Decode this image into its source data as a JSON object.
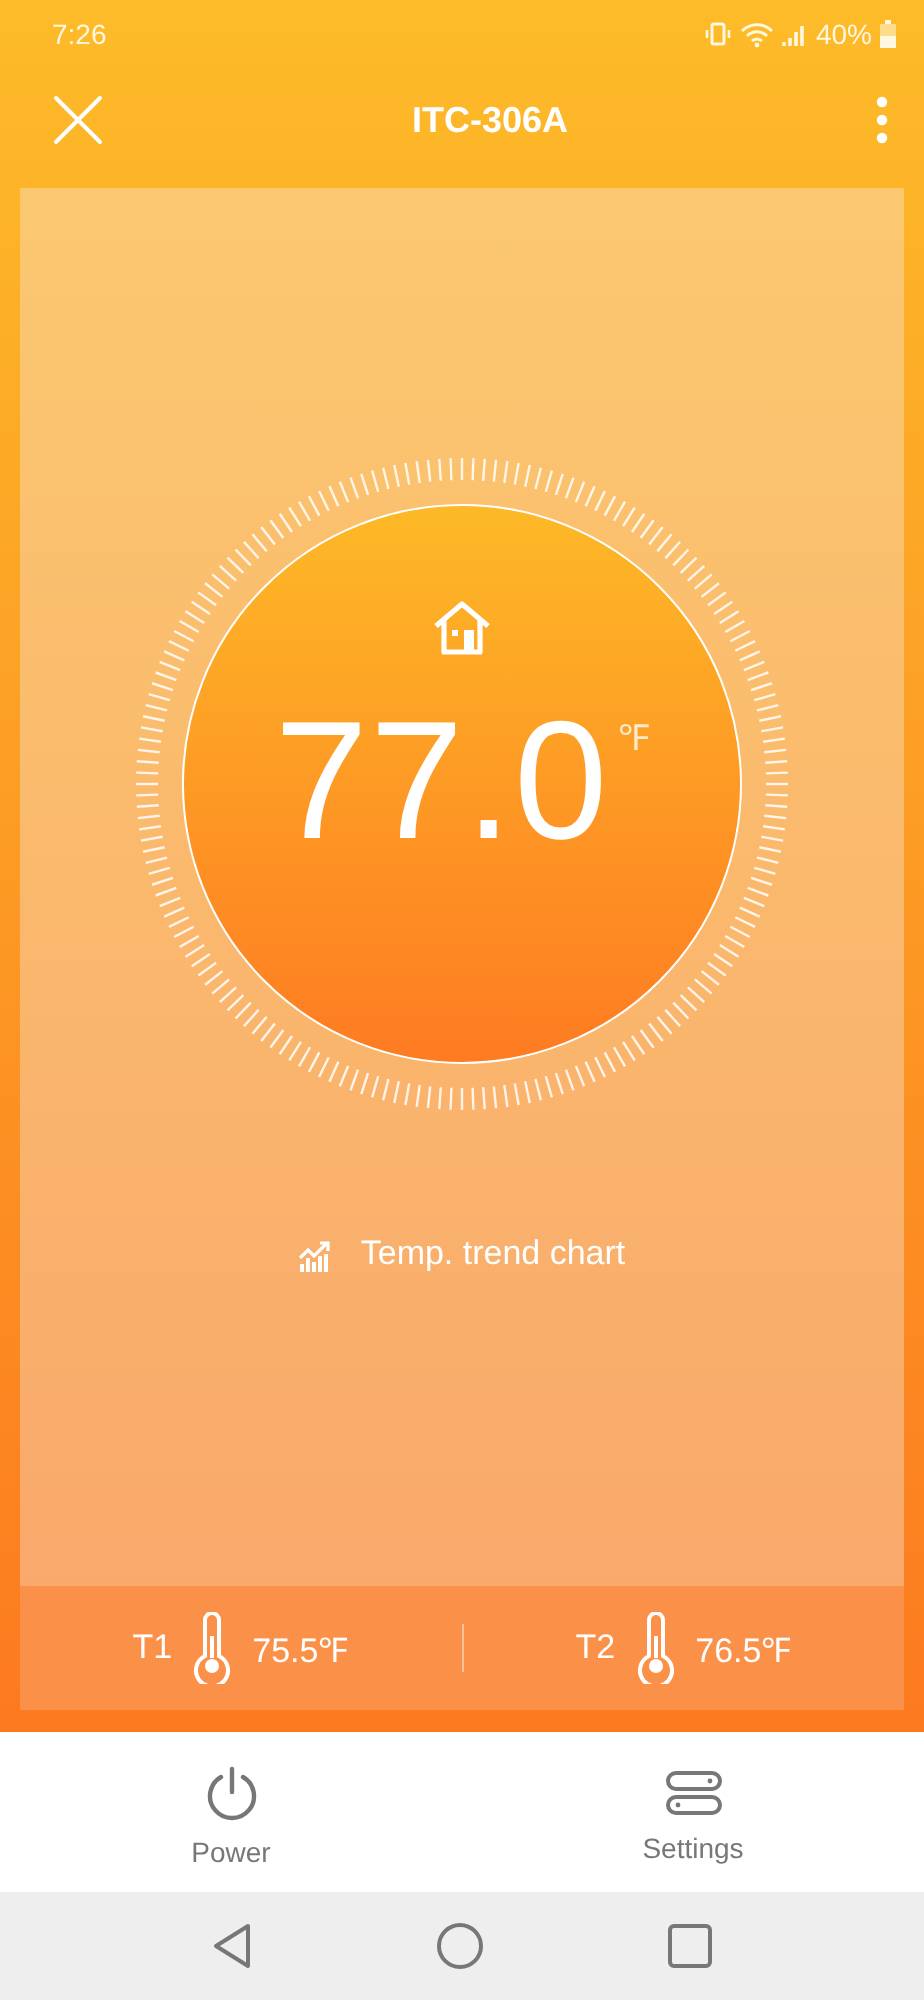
{
  "status_bar": {
    "time": "7:26",
    "battery": "40%"
  },
  "header": {
    "title": "ITC-306A"
  },
  "thermostat": {
    "temperature": "77.0",
    "unit": "℉"
  },
  "trend_link": {
    "label": "Temp. trend chart"
  },
  "sensors": [
    {
      "label": "T1",
      "reading": "75.5℉"
    },
    {
      "label": "T2",
      "reading": "76.5℉"
    }
  ],
  "bottom_nav": [
    {
      "label": "Power",
      "kind": "power"
    },
    {
      "label": "Settings",
      "kind": "settings"
    }
  ]
}
